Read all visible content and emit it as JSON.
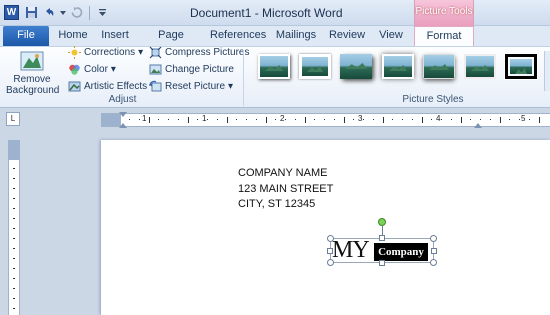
{
  "window": {
    "app_icon": "W",
    "title": "Document1 - Microsoft Word",
    "contextual_tab_group": "Picture Tools"
  },
  "quick_access": [
    {
      "name": "save-icon"
    },
    {
      "name": "undo-icon"
    },
    {
      "name": "redo-icon"
    },
    {
      "name": "customize-qat-icon"
    }
  ],
  "tabs": {
    "file": "File",
    "home": "Home",
    "insert": "Insert",
    "page_layout": "Page Layout",
    "references": "References",
    "mailings": "Mailings",
    "review": "Review",
    "view": "View",
    "format": "Format"
  },
  "ribbon": {
    "adjust": {
      "label": "Adjust",
      "remove_background": [
        "Remove",
        "Background"
      ],
      "corrections": "Corrections",
      "color": "Color",
      "artistic_effects": "Artistic Effects",
      "compress_pictures": "Compress Pictures",
      "change_picture": "Change Picture",
      "reset_picture": "Reset Picture"
    },
    "picture_styles": {
      "label": "Picture Styles"
    }
  },
  "ruler": {
    "tab_selector": "L",
    "numbers": [
      "1",
      "1",
      "2",
      "3",
      "4",
      "5"
    ]
  },
  "document": {
    "address_lines": [
      "COMPANY NAME",
      "123 MAIN STREET",
      "CITY, ST 12345"
    ],
    "logo_text": "MY",
    "logo_box_text": "Company"
  },
  "colors": {
    "file_tab": "#2a62b6",
    "contextual_tab": "#ec9fc0",
    "selection_handle": "#6a7e99",
    "rotation_handle": "#7bd159"
  }
}
